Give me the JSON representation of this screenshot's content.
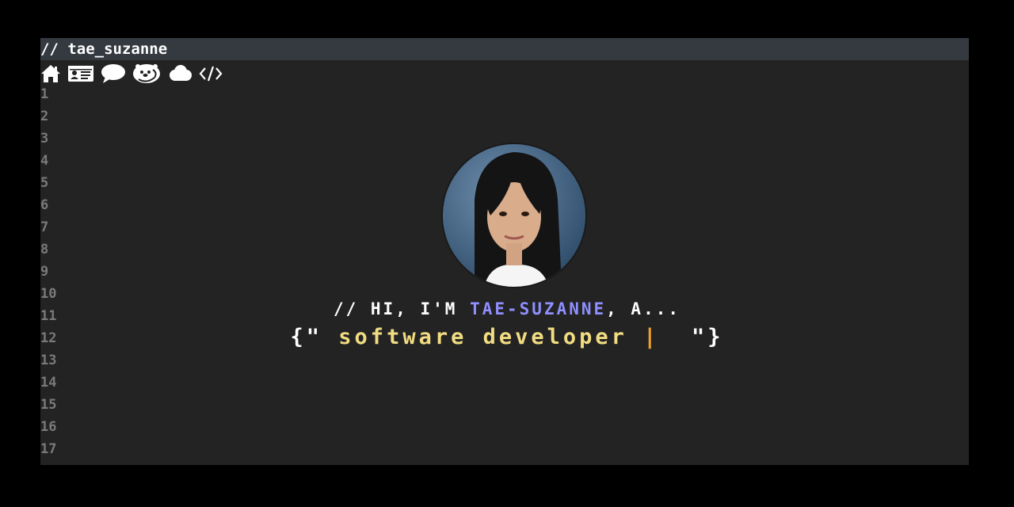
{
  "window": {
    "title": "// tae_suzanne"
  },
  "nav": [
    {
      "icon": "home-icon",
      "label": "home"
    },
    {
      "icon": "id-card-icon",
      "label": "about"
    },
    {
      "icon": "speech-bubble-icon",
      "label": "contact"
    },
    {
      "icon": "otter-icon",
      "label": "fun"
    },
    {
      "icon": "cloud-icon",
      "label": "cloud"
    },
    {
      "icon": "code-icon",
      "label": "code"
    }
  ],
  "line_numbers": [
    "1",
    "2",
    "3",
    "4",
    "5",
    "6",
    "7",
    "8",
    "9",
    "10",
    "11",
    "12",
    "13",
    "14",
    "15",
    "16",
    "17"
  ],
  "hero": {
    "intro_prefix": "// HI, I'M ",
    "intro_name": "TAE-SUZANNE",
    "intro_suffix": ", A...",
    "typed_open": "{\" ",
    "typed_role": "software developer",
    "typed_cursor": " | ",
    "typed_close": " \"}"
  },
  "colors": {
    "background": "#000000",
    "editor": "#232323",
    "titlebar": "#343a40",
    "line_number": "#7a7a7a",
    "name_accent": "#8f8fff",
    "role_accent": "#f1dc82",
    "cursor_accent": "#f0a32a"
  }
}
